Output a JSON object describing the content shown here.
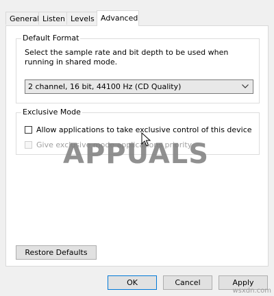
{
  "tabs": [
    {
      "label": "General",
      "active": false
    },
    {
      "label": "Listen",
      "active": false
    },
    {
      "label": "Levels",
      "active": false
    },
    {
      "label": "Advanced",
      "active": true
    }
  ],
  "default_format": {
    "title": "Default Format",
    "description": "Select the sample rate and bit depth to be used when running in shared mode.",
    "selected": "2 channel, 16 bit, 44100 Hz (CD Quality)"
  },
  "exclusive_mode": {
    "title": "Exclusive Mode",
    "allow_label": "Allow applications to take exclusive control of this device",
    "allow_checked": false,
    "priority_label": "Give exclusive mode applications priority",
    "priority_checked": false,
    "priority_enabled": false
  },
  "restore_defaults_label": "Restore Defaults",
  "footer": {
    "ok_label": "OK",
    "cancel_label": "Cancel",
    "apply_label": "Apply"
  },
  "watermark": "APPUALS",
  "credit": "wsxdn.com",
  "colors": {
    "focus_border": "#0078d7",
    "window_bg": "#f0f0f0",
    "panel_bg": "#ffffff"
  }
}
